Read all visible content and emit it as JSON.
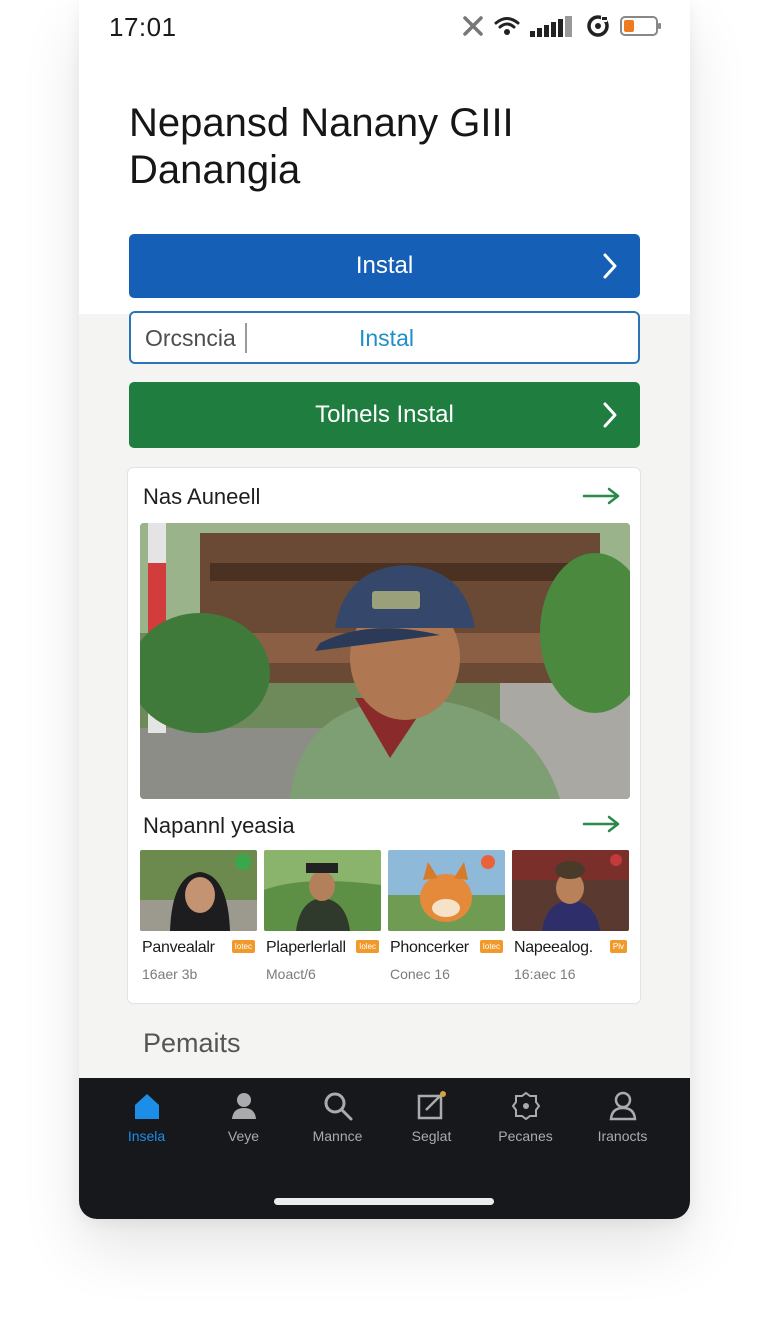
{
  "status": {
    "time": "17:01"
  },
  "header": {
    "title_line1": "Nepansd Nanany GIII",
    "title_line2": "Danangia"
  },
  "buttons": {
    "primary_label": "Instal",
    "secondary_label": "Tolnels Instal"
  },
  "search": {
    "value": "Orcsncia",
    "action_label": "Instal"
  },
  "card": {
    "title": "Nas Auneell",
    "subtitle": "Napannl yeasia",
    "items": [
      {
        "name": "Panvealalr",
        "badge": "Iotec",
        "meta": "16aer 3b"
      },
      {
        "name": "Plaperlerlall",
        "badge": "Iolec",
        "meta": "Moact/6"
      },
      {
        "name": "Phoncerker",
        "badge": "Iotec",
        "meta": "Conec 16"
      },
      {
        "name": "Napeealog.",
        "badge": "Plv",
        "meta": "16:aec 16"
      }
    ]
  },
  "section": {
    "title": "Pemaits"
  },
  "tabs": [
    {
      "label": "Insela",
      "icon": "home-icon",
      "active": true
    },
    {
      "label": "Veye",
      "icon": "person-icon"
    },
    {
      "label": "Mannce",
      "icon": "search-icon"
    },
    {
      "label": "Seglat",
      "icon": "edit-icon"
    },
    {
      "label": "Pecanes",
      "icon": "badge-icon"
    },
    {
      "label": "Iranocts",
      "icon": "profile-icon"
    }
  ],
  "colors": {
    "primary": "#1560b6",
    "success": "#1e7d3f",
    "accent": "#1d8ee8",
    "tabbar": "#16181b"
  }
}
